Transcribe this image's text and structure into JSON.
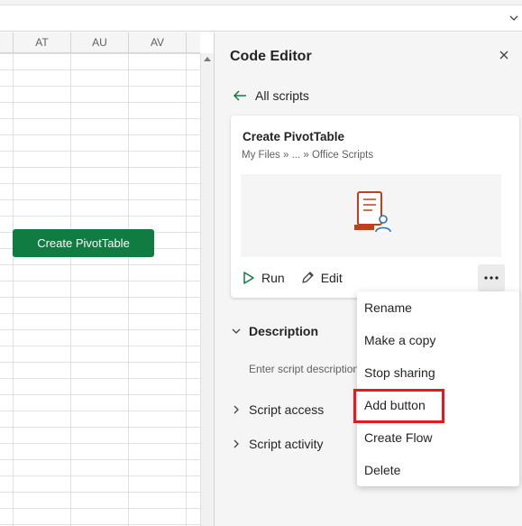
{
  "sheet": {
    "columns": [
      "AT",
      "AU",
      "AV"
    ],
    "button_label": "Create PivotTable",
    "button_color": "#107c41"
  },
  "pane": {
    "title": "Code Editor",
    "back_label": "All scripts",
    "card": {
      "title": "Create PivotTable",
      "path": "My Files » ... » Office Scripts",
      "run_label": "Run",
      "edit_label": "Edit"
    },
    "sections": {
      "description_label": "Description",
      "description_placeholder": "Enter script description",
      "script_access_label": "Script access",
      "script_activity_label": "Script activity"
    }
  },
  "menu": {
    "items": [
      "Rename",
      "Make a copy",
      "Stop sharing",
      "Add button",
      "Create Flow",
      "Delete"
    ],
    "highlighted": "Add button",
    "highlight_color": "#e11b22"
  },
  "icons": {
    "back": "arrow-left-icon",
    "close": "close-icon",
    "run": "play-icon",
    "edit": "pencil-icon",
    "more": "more-horizontal-icon",
    "expand": "chevron-right-icon",
    "collapse": "chevron-down-icon",
    "preview": "script-document-icon"
  },
  "accent_color": "#107c41"
}
